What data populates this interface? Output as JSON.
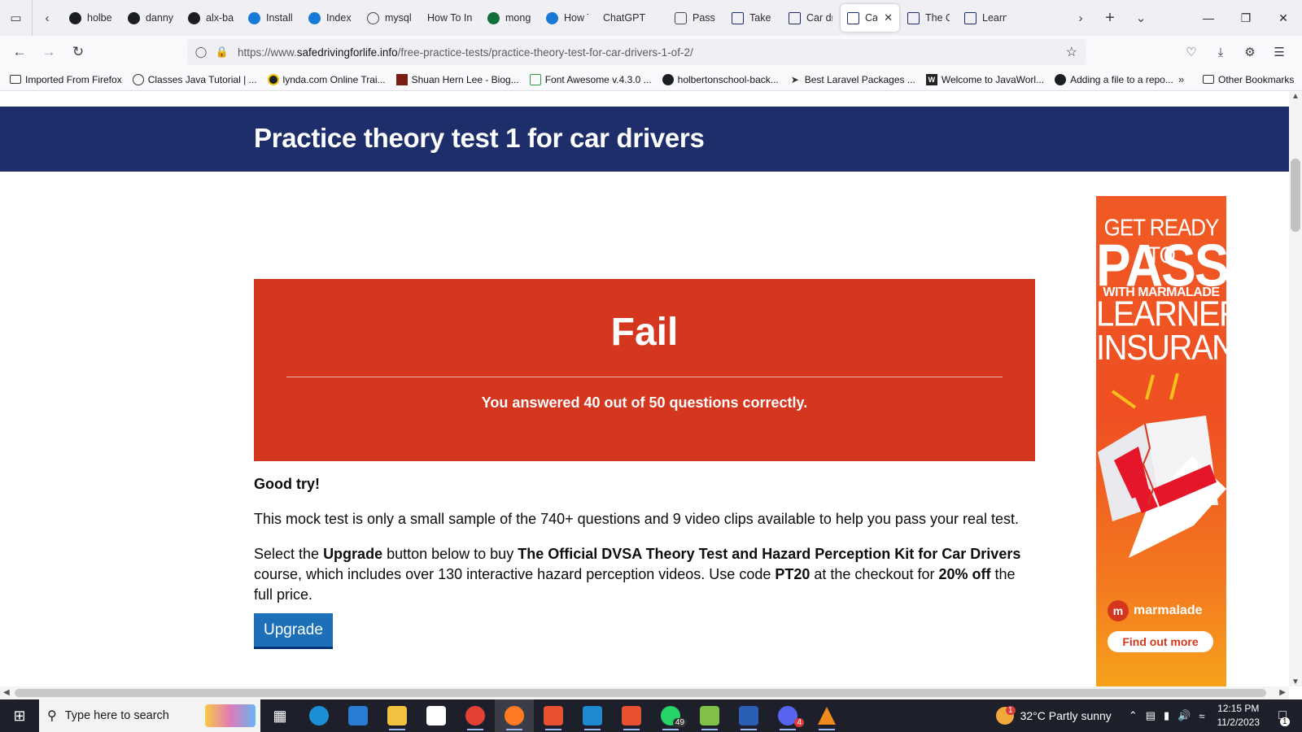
{
  "browser": {
    "tabs": [
      {
        "icon": "github-icon",
        "label": "holbe"
      },
      {
        "icon": "github-icon",
        "label": "danny"
      },
      {
        "icon": "github-icon",
        "label": "alx-ba"
      },
      {
        "icon": "edge-icon",
        "label": "Install"
      },
      {
        "icon": "edge-icon",
        "label": "Index"
      },
      {
        "icon": "globe-icon",
        "label": "mysql"
      },
      {
        "icon": "none",
        "label": "How To In"
      },
      {
        "icon": "mongodb-icon",
        "label": "mong"
      },
      {
        "icon": "edge-icon",
        "label": "How T"
      },
      {
        "icon": "none",
        "label": "ChatGPT"
      },
      {
        "icon": "chatgpt-icon",
        "label": "Pass U"
      },
      {
        "icon": "dvsa-icon",
        "label": "Take a"
      },
      {
        "icon": "dvsa-icon",
        "label": "Car dr"
      },
      {
        "icon": "dvsa-icon",
        "label": "Car",
        "active": true
      },
      {
        "icon": "dvsa-icon",
        "label": "The O"
      },
      {
        "icon": "dvsa-icon",
        "label": "Learn"
      }
    ],
    "url": {
      "prefix": "https://www.",
      "domain": "safedrivingforlife.info",
      "path": "/free-practice-tests/practice-theory-test-for-car-drivers-1-of-2/"
    },
    "bookmarks": [
      {
        "icon": "folder-icon",
        "label": "Imported From Firefox"
      },
      {
        "icon": "globe-icon",
        "label": "Classes Java Tutorial | ..."
      },
      {
        "icon": "lynda-icon",
        "label": "lynda.com Online Trai..."
      },
      {
        "icon": "photo-icon",
        "label": "Shuan Hern Lee - Biog..."
      },
      {
        "icon": "doc-icon",
        "label": "Font Awesome v.4.3.0 ..."
      },
      {
        "icon": "github-icon",
        "label": "holbertonschool-back..."
      },
      {
        "icon": "paper-plane-icon",
        "label": "Best Laravel Packages ..."
      },
      {
        "icon": "javaworld-icon",
        "label": "Welcome to JavaWorl..."
      },
      {
        "icon": "github-icon",
        "label": "Adding a file to a repo..."
      }
    ],
    "other_bookmarks": "Other Bookmarks"
  },
  "page": {
    "hero_title": "Practice theory test 1 for car drivers",
    "result_title": "Fail",
    "result_score": "You answered 40 out of 50 questions correctly.",
    "good_try": "Good try!",
    "para1": "This mock test is only a small sample of the 740+ questions and 9 video clips available to help you pass your real test.",
    "para2": {
      "t1": "Select the ",
      "b1": "Upgrade",
      "t2": " button below to buy ",
      "b2": "The Official DVSA Theory Test and Hazard Perception Kit for Car Drivers",
      "t3": " course, which includes over 130 interactive hazard perception videos. Use code ",
      "b3": "PT20",
      "t4": " at the checkout for ",
      "b4": "20% off",
      "t5": " the full price."
    },
    "upgrade_button": "Upgrade",
    "ad": {
      "line1": "GET READY TO",
      "line2": "PASS",
      "line3": "WITH MARMALADE",
      "line4a": "LEARNER",
      "line4b": "INSURANCE!",
      "brand": "marmalade",
      "cta": "Find out more"
    }
  },
  "taskbar": {
    "search_placeholder": "Type here to search",
    "whatsapp_badge": "49",
    "discord_badge": "4",
    "weather_badge": "1",
    "weather": "32°C  Partly sunny",
    "time": "12:15 PM",
    "date": "11/2/2023",
    "notification_count": "1"
  },
  "colors": {
    "hero": "#1d2e6b",
    "fail": "#d4361e",
    "upgrade": "#1d70b8",
    "ad": "#f05a24"
  }
}
